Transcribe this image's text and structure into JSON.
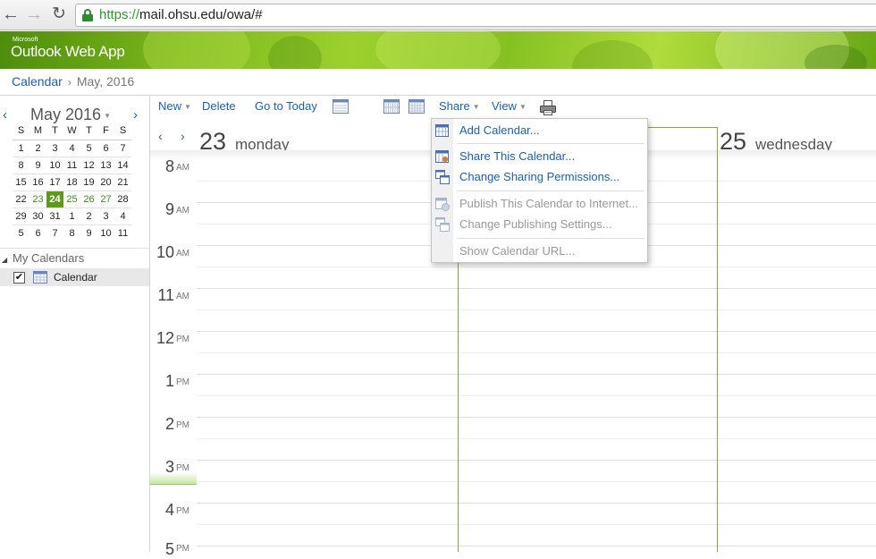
{
  "browser": {
    "url_scheme": "https://",
    "url_rest": "mail.ohsu.edu/owa/#",
    "lock_color": "#2e8b2e"
  },
  "banner": {
    "brand_small": "Microsoft",
    "app_name": "Outlook Web App",
    "accent_color": "#79b51b"
  },
  "breadcrumb": {
    "root": "Calendar",
    "separator": "›",
    "current": "May, 2016"
  },
  "mini_calendar": {
    "title": "May 2016",
    "weekday_headers": [
      "S",
      "M",
      "T",
      "W",
      "T",
      "F",
      "S"
    ],
    "weeks": [
      [
        "1",
        "2",
        "3",
        "4",
        "5",
        "6",
        "7"
      ],
      [
        "8",
        "9",
        "10",
        "11",
        "12",
        "13",
        "14"
      ],
      [
        "15",
        "16",
        "17",
        "18",
        "19",
        "20",
        "21"
      ],
      [
        "22",
        "23",
        "24",
        "25",
        "26",
        "27",
        "28"
      ],
      [
        "29",
        "30",
        "31",
        "1",
        "2",
        "3",
        "4"
      ],
      [
        "5",
        "6",
        "7",
        "8",
        "9",
        "10",
        "11"
      ]
    ],
    "today": "24",
    "selected_range": [
      "23",
      "24",
      "25",
      "26",
      "27"
    ],
    "today_color": "#5c9a1e"
  },
  "my_calendars": {
    "label": "My Calendars",
    "items": [
      {
        "label": "Calendar",
        "checked": true
      }
    ]
  },
  "toolbar": {
    "new_label": "New",
    "delete_label": "Delete",
    "today_label": "Go to Today",
    "share_label": "Share",
    "view_label": "View",
    "active_view": "work-week"
  },
  "days": [
    {
      "number": "23",
      "name": "monday"
    },
    {
      "number": "25",
      "name": "wednesday"
    }
  ],
  "time_slots": [
    {
      "hour": "8",
      "ampm": "AM"
    },
    {
      "hour": "9",
      "ampm": "AM"
    },
    {
      "hour": "10",
      "ampm": "AM"
    },
    {
      "hour": "11",
      "ampm": "AM"
    },
    {
      "hour": "12",
      "ampm": "PM"
    },
    {
      "hour": "1",
      "ampm": "PM"
    },
    {
      "hour": "2",
      "ampm": "PM"
    },
    {
      "hour": "3",
      "ampm": "PM"
    },
    {
      "hour": "4",
      "ampm": "PM"
    },
    {
      "hour": "5",
      "ampm": "PM"
    }
  ],
  "share_menu": {
    "items": [
      {
        "label": "Add Calendar...",
        "enabled": true
      },
      {
        "label": "Share This Calendar...",
        "enabled": true
      },
      {
        "label": "Change Sharing Permissions...",
        "enabled": true
      },
      {
        "label": "Publish This Calendar to Internet...",
        "enabled": false
      },
      {
        "label": "Change Publishing Settings...",
        "enabled": false
      },
      {
        "label": "Show Calendar URL...",
        "enabled": false
      }
    ]
  }
}
